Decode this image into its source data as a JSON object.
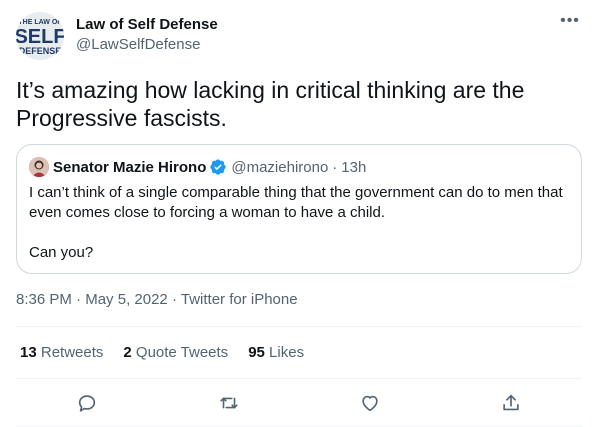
{
  "tweet": {
    "author_name": "Law of Self Defense",
    "author_handle": "@LawSelfDefense",
    "avatar_text": {
      "top": "THE LAW OF",
      "main": "SELF",
      "bottom": "DEFENSE"
    },
    "more_label": "•••",
    "text_line1": "It’s amazing how lacking in critical thinking are the",
    "text_line2": "Progressive fascists.",
    "time": "8:36 PM",
    "date": "May 5, 2022",
    "source": "Twitter for iPhone",
    "separator": "·"
  },
  "quoted": {
    "author_name": "Senator Mazie Hirono",
    "author_handle": "@maziehirono",
    "separator": "·",
    "relative_time": "13h",
    "paragraph1": "I can’t think of a single comparable thing that the government can do to men that even comes close to forcing a woman to have a child.",
    "paragraph2": "Can you?"
  },
  "stats": {
    "retweets_count": "13",
    "retweets_label": "Retweets",
    "quotes_count": "2",
    "quotes_label": "Quote Tweets",
    "likes_count": "95",
    "likes_label": "Likes"
  },
  "actions": [
    "reply-icon",
    "retweet-icon",
    "like-icon",
    "share-icon"
  ],
  "colors": {
    "text": "#0f1419",
    "secondary": "#536471",
    "border": "#cfd9de",
    "divider": "#eff3f4",
    "verified": "#1d9bf0"
  }
}
